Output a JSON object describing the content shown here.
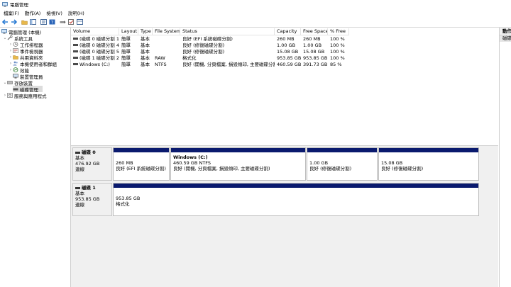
{
  "window": {
    "title": "電腦管理"
  },
  "menu": [
    {
      "label": "檔案(F)"
    },
    {
      "label": "動作(A)"
    },
    {
      "label": "檢視(V)"
    },
    {
      "label": "說明(H)"
    }
  ],
  "toolbar": {
    "icons": [
      "back-arrow-icon",
      "forward-arrow-icon",
      "up-folder-icon",
      "console-tree-icon",
      "properties-icon",
      "help-icon",
      "show-hide-pane-icon",
      "check-icon",
      "view-icon"
    ]
  },
  "tree": {
    "root": "電腦管理 (本機)",
    "items": [
      {
        "label": "系統工具"
      },
      {
        "label": "工作排程器"
      },
      {
        "label": "事件檢視器"
      },
      {
        "label": "共用資料夾"
      },
      {
        "label": "本機使用者和群組"
      },
      {
        "label": "效能"
      },
      {
        "label": "裝置管理員"
      },
      {
        "label": "存放裝置"
      },
      {
        "label": "磁碟管理"
      },
      {
        "label": "服務與應用程式"
      }
    ]
  },
  "volumes": {
    "headers": [
      "Volume",
      "Layout",
      "Type",
      "File System",
      "Status",
      "Capacity",
      "Free Space",
      "% Free"
    ],
    "rows": [
      {
        "volume": "(磁碟 0 磁碟分割 1)",
        "layout": "簡單",
        "type": "基本",
        "fs": "",
        "status": "良好 (EFI 系統磁碟分割)",
        "capacity": "260 MB",
        "free": "260 MB",
        "pct": "100 %"
      },
      {
        "volume": "(磁碟 0 磁碟分割 4)",
        "layout": "簡單",
        "type": "基本",
        "fs": "",
        "status": "良好 (修復磁碟分割)",
        "capacity": "1.00 GB",
        "free": "1.00 GB",
        "pct": "100 %"
      },
      {
        "volume": "(磁碟 0 磁碟分割 5)",
        "layout": "簡單",
        "type": "基本",
        "fs": "",
        "status": "良好 (修復磁碟分割)",
        "capacity": "15.08 GB",
        "free": "15.08 GB",
        "pct": "100 %"
      },
      {
        "volume": "(磁碟 1 磁碟分割 2)",
        "layout": "簡單",
        "type": "基本",
        "fs": "RAW",
        "status": "格式化",
        "capacity": "953.85 GB",
        "free": "953.85 GB",
        "pct": "100 %"
      },
      {
        "volume": "Windows (C:)",
        "layout": "簡單",
        "type": "基本",
        "fs": "NTFS",
        "status": "良好 (開機, 分頁檔案, 損毀傾印, 主要磁碟分割)",
        "capacity": "460.59 GB",
        "free": "391.73 GB",
        "pct": "85 %"
      }
    ]
  },
  "disks": [
    {
      "name": "磁碟 0",
      "type": "基本",
      "size": "476.92 GB",
      "status": "連線",
      "partitions": [
        {
          "name": "",
          "line1": "260 MB",
          "line2": "良好 (EFI 系統磁碟分割)"
        },
        {
          "name": "Windows  (C:)",
          "line1": "460.59 GB NTFS",
          "line2": "良好 (開機, 分頁檔案, 損毀傾印, 主要磁碟分割)"
        },
        {
          "name": "",
          "line1": "1.00 GB",
          "line2": "良好 (修復磁碟分割)"
        },
        {
          "name": "",
          "line1": "15.08 GB",
          "line2": "良好 (修復磁碟分割)"
        }
      ]
    },
    {
      "name": "磁碟 1",
      "type": "基本",
      "size": "953.85 GB",
      "status": "連線",
      "partitions": [
        {
          "name": "",
          "line1": "953.85 GB",
          "line2": "格式化"
        }
      ]
    }
  ],
  "actions": {
    "header": "動作",
    "sub": "磁碟"
  },
  "colors": {
    "partition_bar": "#0a1a6e",
    "selection": "#dcdcdc"
  }
}
